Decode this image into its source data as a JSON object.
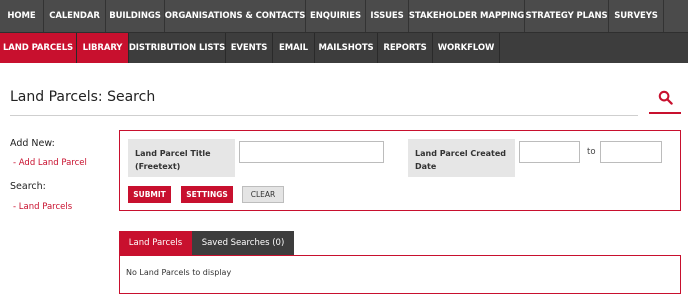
{
  "nav_primary": [
    {
      "label": "HOME"
    },
    {
      "label": "CALENDAR"
    },
    {
      "label": "BUILDINGS"
    },
    {
      "label": "ORGANISATIONS & CONTACTS"
    },
    {
      "label": "ENQUIRIES"
    },
    {
      "label": "ISSUES"
    },
    {
      "label": "STAKEHOLDER MAPPING"
    },
    {
      "label": "STRATEGY PLANS"
    },
    {
      "label": "SURVEYS"
    }
  ],
  "nav_secondary": [
    {
      "label": "LAND PARCELS",
      "active": true
    },
    {
      "label": "LIBRARY",
      "active": true
    },
    {
      "label": "DISTRIBUTION LISTS"
    },
    {
      "label": "EVENTS"
    },
    {
      "label": "EMAIL"
    },
    {
      "label": "MAILSHOTS"
    },
    {
      "label": "REPORTS"
    },
    {
      "label": "WORKFLOW"
    }
  ],
  "page": {
    "title": "Land Parcels: Search"
  },
  "sidebar": {
    "add_new_heading": "Add New:",
    "add_link": "- Add Land Parcel",
    "search_heading": "Search:",
    "search_link": "- Land Parcels"
  },
  "filters": {
    "title_label": "Land Parcel Title (Freetext)",
    "title_value": "",
    "created_label": "Land Parcel Created Date",
    "created_from": "",
    "to_label": "to",
    "created_to": ""
  },
  "buttons": {
    "submit": "SUBMIT",
    "settings": "SETTINGS",
    "clear": "CLEAR"
  },
  "results_tabs": [
    {
      "label": "Land Parcels",
      "active": true
    },
    {
      "label": "Saved Searches (0)",
      "active": false
    }
  ],
  "results": {
    "empty_message": "No Land Parcels to display"
  },
  "colors": {
    "accent": "#c8102e",
    "nav_bg": "#4b4b4b",
    "nav2_bg": "#3d3d3d"
  },
  "icons": {
    "search": "search-icon"
  }
}
